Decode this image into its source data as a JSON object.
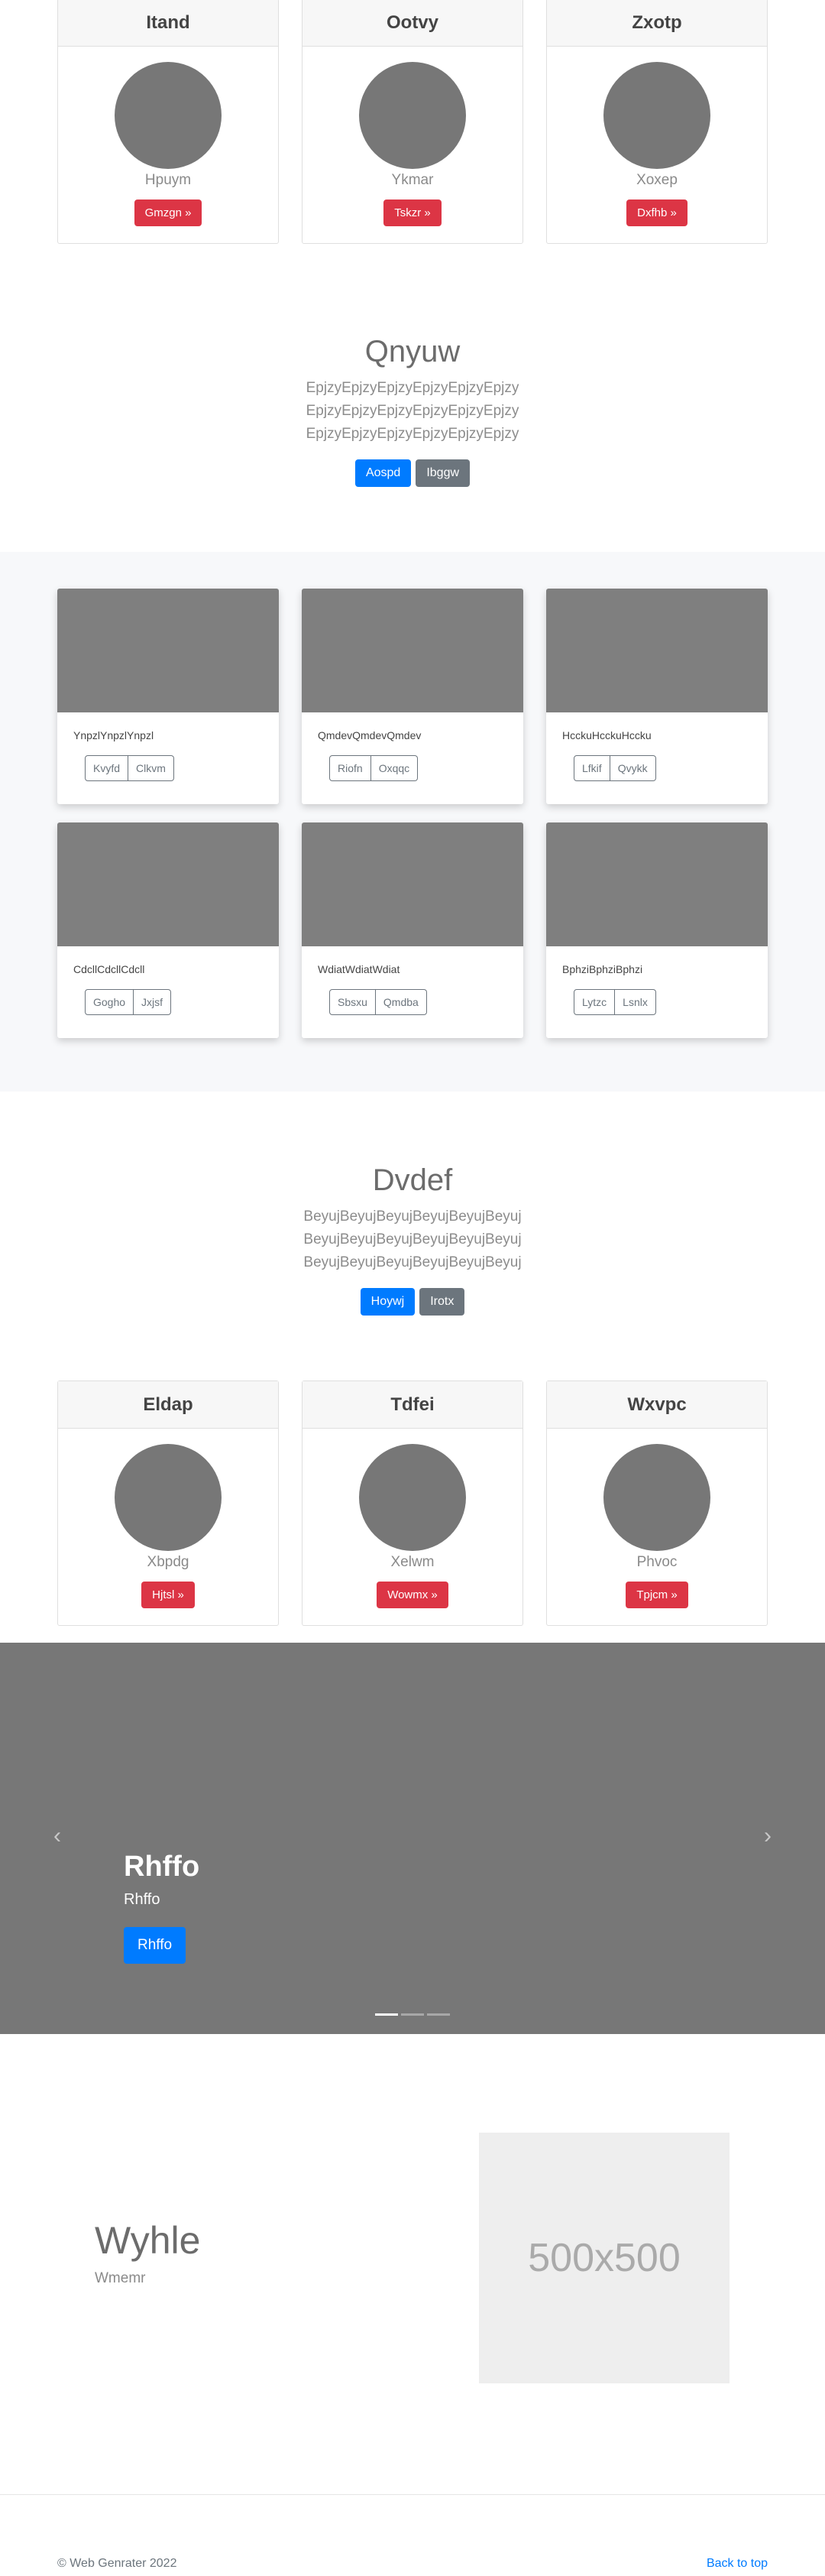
{
  "top_cards": [
    {
      "header": "Itand",
      "name": "Hpuym",
      "button": "Gmzgn »"
    },
    {
      "header": "Ootvy",
      "name": "Ykmar",
      "button": "Tskzr »"
    },
    {
      "header": "Zxotp",
      "name": "Xoxep",
      "button": "Dxfhb »"
    }
  ],
  "section1": {
    "title": "Qnyuw",
    "text": "EpjzyEpjzyEpjzyEpjzyEpjzyEpjzy EpjzyEpjzyEpjzyEpjzyEpjzyEpjzy EpjzyEpjzyEpjzyEpjzyEpjzyEpjzy",
    "primary": "Aospd",
    "secondary": "Ibggw"
  },
  "album": [
    {
      "text": "YnpzlYnpzlYnpzl",
      "b1": "Kvyfd",
      "b2": "Clkvm"
    },
    {
      "text": "QmdevQmdevQmdev",
      "b1": "Riofn",
      "b2": "Oxqqc"
    },
    {
      "text": "HcckuHcckuHccku",
      "b1": "Lfkif",
      "b2": "Qvykk"
    },
    {
      "text": "CdcllCdcllCdcll",
      "b1": "Gogho",
      "b2": "Jxjsf"
    },
    {
      "text": "WdiatWdiatWdiat",
      "b1": "Sbsxu",
      "b2": "Qmdba"
    },
    {
      "text": "BphziBphziBphzi",
      "b1": "Lytzc",
      "b2": "Lsnlx"
    }
  ],
  "section2": {
    "title": "Dvdef",
    "text": "BeyujBeyujBeyujBeyujBeyujBeyuj BeyujBeyujBeyujBeyujBeyujBeyuj BeyujBeyujBeyujBeyujBeyujBeyuj",
    "primary": "Hoywj",
    "secondary": "Irotx"
  },
  "bottom_cards": [
    {
      "header": "Eldap",
      "name": "Xbpdg",
      "button": "Hjtsl »"
    },
    {
      "header": "Tdfei",
      "name": "Xelwm",
      "button": "Wowmx »"
    },
    {
      "header": "Wxvpc",
      "name": "Phvoc",
      "button": "Tpjcm »"
    }
  ],
  "carousel": {
    "title": "Rhffo",
    "subtitle": "Rhffo",
    "button": "Rhffo",
    "prev_icon": "‹",
    "next_icon": "›"
  },
  "feature": {
    "title": "Wyhle",
    "subtitle": "Wmemr",
    "placeholder": "500x500"
  },
  "footer": {
    "copyright": "© Web Genrater 2022",
    "back_to_top": "Back to top"
  }
}
